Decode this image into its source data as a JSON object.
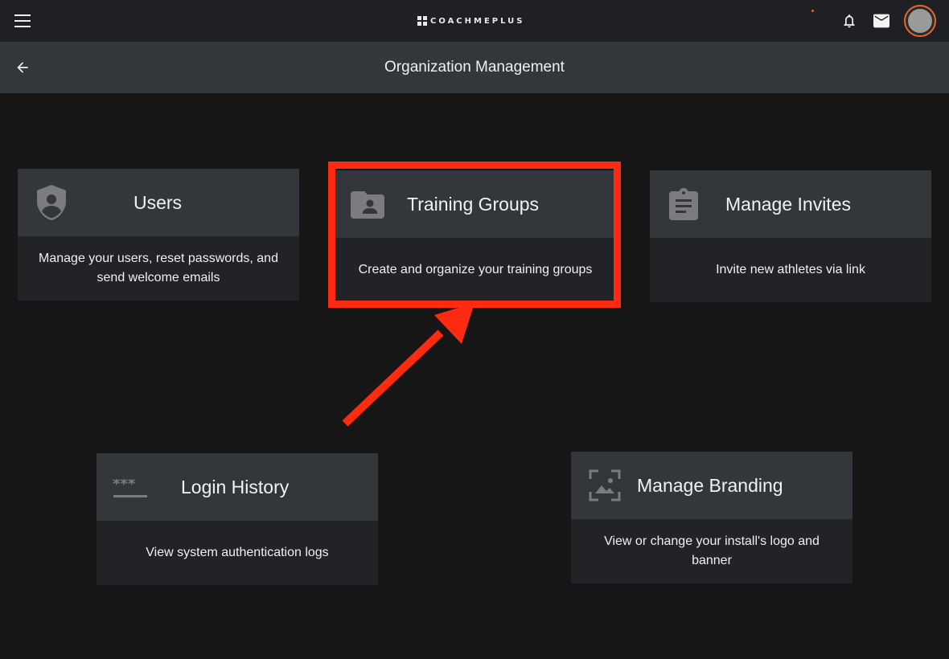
{
  "header": {
    "brand": "COACHMEPLUS",
    "menu_icon": "hamburger-menu-icon",
    "notifications_icon": "bell-icon",
    "messages_icon": "mail-icon",
    "accent_color": "#e8642a"
  },
  "subheader": {
    "title": "Organization Management",
    "back_icon": "arrow-left-icon"
  },
  "cards": [
    {
      "title": "Users",
      "description": "Manage your users, reset passwords, and send welcome emails",
      "icon": "shield-account-icon"
    },
    {
      "title": "Training Groups",
      "description": "Create and organize your training groups",
      "icon": "folder-account-icon"
    },
    {
      "title": "Manage Invites",
      "description": "Invite new athletes via link",
      "icon": "clipboard-text-icon"
    },
    {
      "title": "Login History",
      "description": "View system authentication logs",
      "icon": "password-asterisks-icon"
    },
    {
      "title": "Manage Branding",
      "description": "View or change your install's logo and banner",
      "icon": "image-frame-icon"
    }
  ],
  "annotation": {
    "color": "#ff2a12"
  }
}
